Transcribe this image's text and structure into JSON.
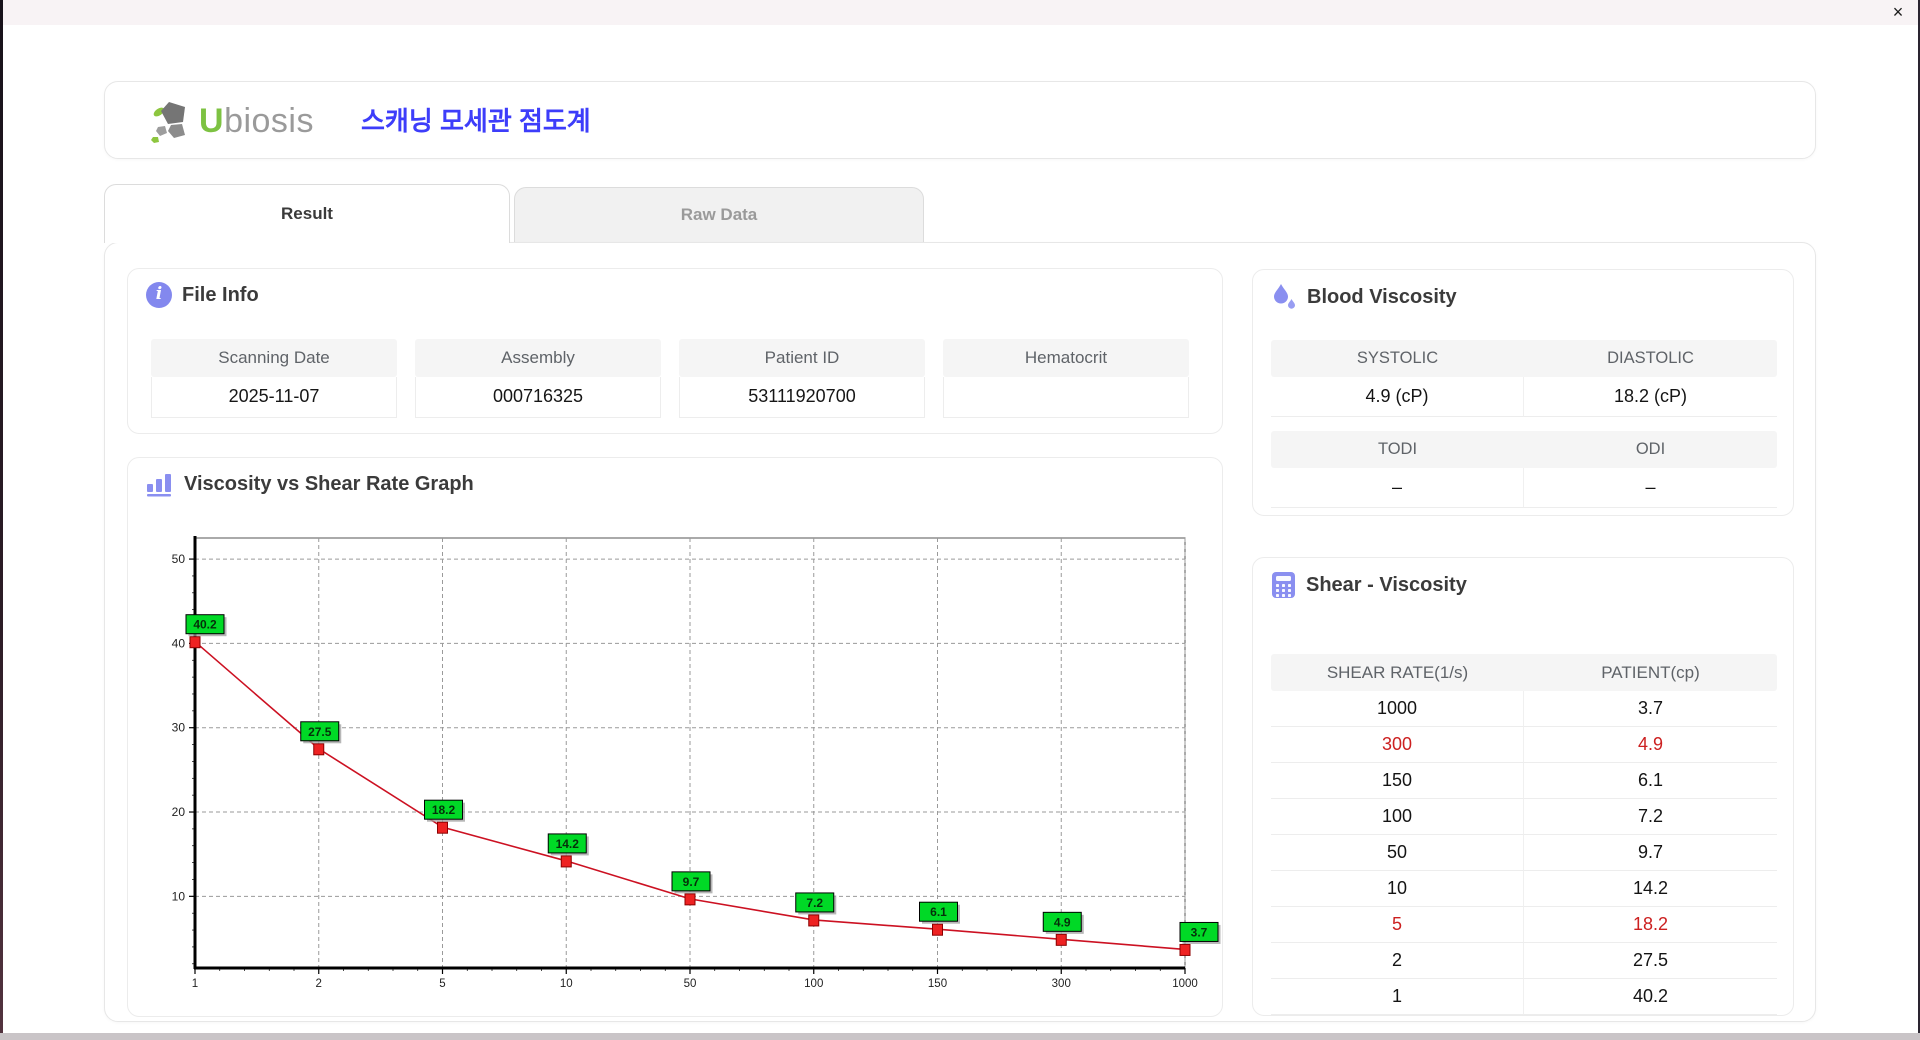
{
  "titlebar": {
    "close_icon": "×"
  },
  "header": {
    "logo": {
      "u": "U",
      "rest": "biosis"
    },
    "app_title": "스캐닝 모세관 점도계"
  },
  "tabs": {
    "result": "Result",
    "raw_data": "Raw Data"
  },
  "file_info": {
    "title": "File Info",
    "fields": [
      {
        "label": "Scanning Date",
        "value": "2025-11-07"
      },
      {
        "label": "Assembly",
        "value": "000716325"
      },
      {
        "label": "Patient ID",
        "value": "53111920700"
      },
      {
        "label": "Hematocrit",
        "value": ""
      }
    ]
  },
  "graph": {
    "title": "Viscosity vs Shear Rate Graph"
  },
  "blood_viscosity": {
    "title": "Blood Viscosity",
    "pressure": {
      "headers": [
        "SYSTOLIC",
        "DIASTOLIC"
      ],
      "values": [
        "4.9 (cP)",
        "18.2 (cP)"
      ]
    },
    "indices": {
      "headers": [
        "TODI",
        "ODI"
      ],
      "values": [
        "–",
        "–"
      ]
    }
  },
  "shear_viscosity": {
    "title": "Shear - Viscosity",
    "columns": [
      "SHEAR RATE(1/s)",
      "PATIENT(cp)"
    ],
    "rows": [
      {
        "shear_rate": "1000",
        "patient": "3.7",
        "highlight": false
      },
      {
        "shear_rate": "300",
        "patient": "4.9",
        "highlight": true
      },
      {
        "shear_rate": "150",
        "patient": "6.1",
        "highlight": false
      },
      {
        "shear_rate": "100",
        "patient": "7.2",
        "highlight": false
      },
      {
        "shear_rate": "50",
        "patient": "9.7",
        "highlight": false
      },
      {
        "shear_rate": "10",
        "patient": "14.2",
        "highlight": false
      },
      {
        "shear_rate": "5",
        "patient": "18.2",
        "highlight": true
      },
      {
        "shear_rate": "2",
        "patient": "27.5",
        "highlight": false
      },
      {
        "shear_rate": "1",
        "patient": "40.2",
        "highlight": false
      }
    ]
  },
  "chart_data": {
    "type": "line",
    "title": "Viscosity vs Shear Rate Graph",
    "x_categories": [
      "1",
      "2",
      "5",
      "10",
      "50",
      "100",
      "150",
      "300",
      "1000"
    ],
    "values": [
      40.2,
      27.5,
      18.2,
      14.2,
      9.7,
      7.2,
      6.1,
      4.9,
      3.7
    ],
    "xlabel": "",
    "ylabel": "",
    "y_ticks": [
      10,
      20,
      30,
      40,
      50
    ],
    "ylim": [
      1.5,
      52.5
    ],
    "x_scale": "category",
    "grid": "dashed",
    "legend": "none",
    "series_color": "#cc1122",
    "marker_color": "#ee2222",
    "point_label_bg": "#00d926"
  },
  "colors": {
    "accent_blue": "#3d3dfa",
    "icon_purple": "#8a8ff0",
    "logo_green": "#7dc242",
    "highlight_red": "#cc2020",
    "titlebar_bg": "#f8f3f5"
  }
}
